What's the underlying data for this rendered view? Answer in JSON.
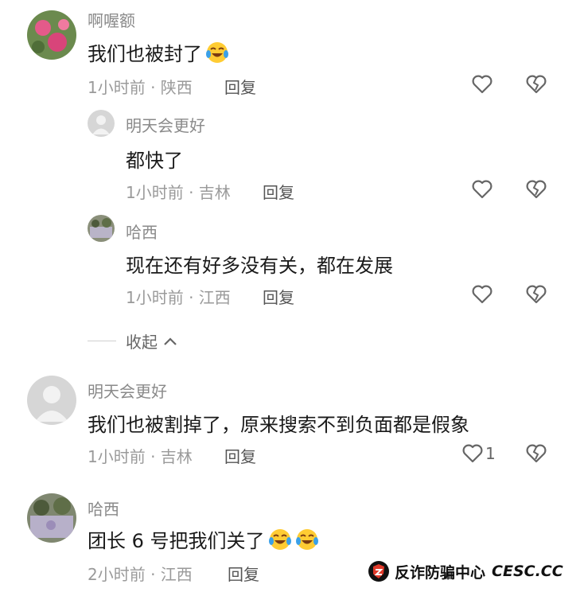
{
  "comments": [
    {
      "username": "啊喔额",
      "text": "我们也被封了",
      "emoji_count": 1,
      "meta": "1小时前 · 陕西",
      "reply_label": "回复",
      "like_count": ""
    },
    {
      "username": "明天会更好",
      "text": "都快了",
      "meta": "1小时前 · 吉林",
      "reply_label": "回复",
      "like_count": ""
    },
    {
      "username": "哈西",
      "text": "现在还有好多没有关，都在发展",
      "meta": "1小时前 · 江西",
      "reply_label": "回复",
      "like_count": ""
    },
    {
      "username": "明天会更好",
      "text": "我们也被割掉了，原来搜索不到负面都是假象",
      "meta": "1小时前 · 吉林",
      "reply_label": "回复",
      "like_count": "1"
    },
    {
      "username": "哈西",
      "text": "团长 6 号把我们关了",
      "emoji_count": 2,
      "meta": "2小时前 · 江西",
      "reply_label": "回复",
      "like_count": ""
    }
  ],
  "collapse_label": "收起",
  "watermark": {
    "text": "反诈防骗中心",
    "site": "CESC.CC",
    "icon": "shield-logo-icon"
  },
  "colors": {
    "background": "#ffffff",
    "username": "#8a8a8a",
    "meta": "#9a9a9a",
    "icon_stroke": "#666666"
  }
}
